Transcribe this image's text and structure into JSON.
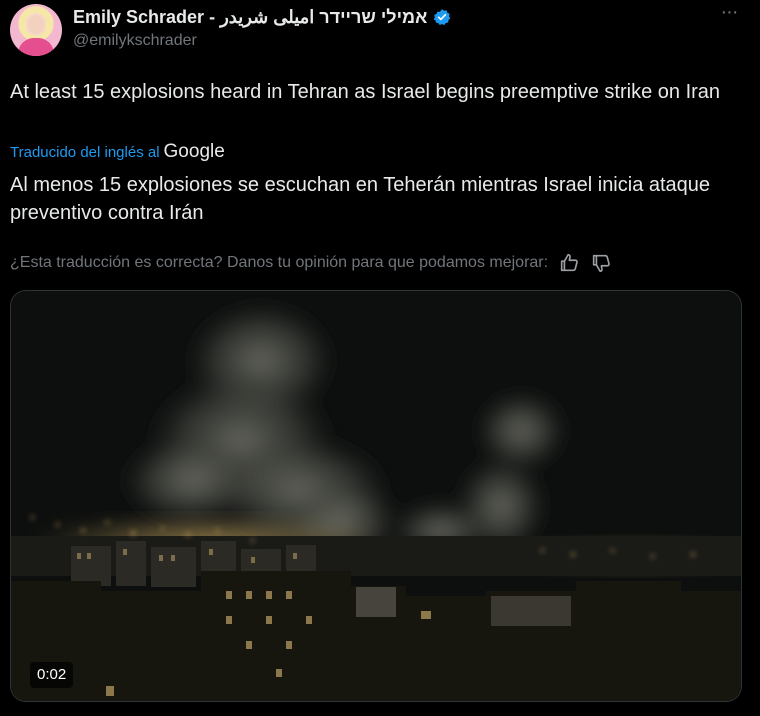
{
  "author": {
    "display_name": "Emily Schrader - אמילי שריידר اميلى شريدر",
    "handle": "@emilykschrader"
  },
  "tweet": {
    "text": "At least 15 explosions heard in Tehran as Israel begins preemptive strike on Iran"
  },
  "translation": {
    "label": "Traducido del inglés al",
    "provider": "Google",
    "text": "Al menos 15 explosiones se escuchan en Teherán mientras Israel inicia ataque preventivo contra Irán",
    "feedback_prompt": "¿Esta traducción es correcta? Danos tu opinión para que podamos mejorar:"
  },
  "media": {
    "timestamp": "0:02"
  },
  "icons": {
    "verified": "verified-badge-icon",
    "more": "more-options-icon",
    "thumbs_up": "thumbs-up-icon",
    "thumbs_down": "thumbs-down-icon"
  },
  "colors": {
    "background": "#000000",
    "text": "#e7e9ea",
    "muted": "#71767b",
    "accent": "#1d9bf0"
  }
}
